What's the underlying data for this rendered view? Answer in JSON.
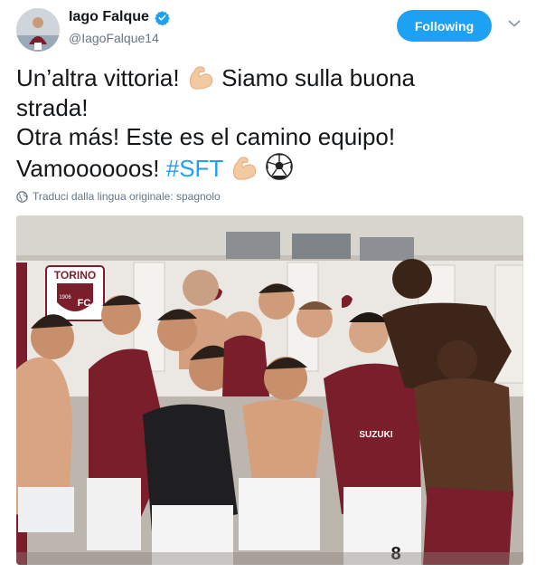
{
  "author": {
    "display_name": "Iago Falque",
    "handle": "@IagoFalque14",
    "verified": true,
    "avatar_icon": "profile-avatar"
  },
  "follow_button": {
    "label": "Following",
    "color": "#1da1f2"
  },
  "menu": {
    "icon": "chevron-down-icon"
  },
  "tweet": {
    "line1_a": "Un’altra vittoria!",
    "line1_emoji": "flexed-biceps",
    "line1_b": "Siamo sulla buona",
    "line2": "strada!",
    "line3": "Otra más! Este es el camino equipo!",
    "line4_a": "Vamoooooos!",
    "hashtag": "#SFT",
    "line4_emojis": [
      "flexed-biceps",
      "soccer-ball"
    ]
  },
  "translate": {
    "icon": "globe-icon",
    "label": "Traduci dalla lingua originale: spagnolo"
  },
  "media": {
    "kind": "photo",
    "wall_sign": "TORINO",
    "wall_badge": "FC",
    "wall_badge_year": "1906",
    "shirt_sponsor": "SUZUKI",
    "shirt_number": "8"
  },
  "colors": {
    "text": "#14171a",
    "secondary": "#657786",
    "link": "#1da1f2",
    "maroon": "#7a1e2c"
  }
}
